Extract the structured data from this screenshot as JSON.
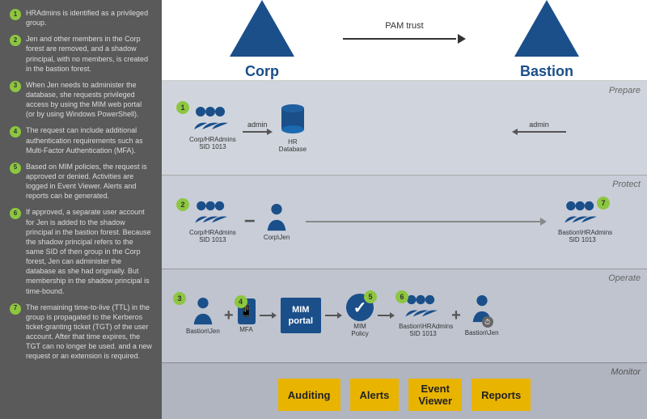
{
  "leftPanel": {
    "steps": [
      {
        "num": "1",
        "text": "HRAdmins is identified as a privileged group."
      },
      {
        "num": "2",
        "text": "Jen and other members in the Corp forest are removed, and a shadow principal, with no members, is created in the bastion forest."
      },
      {
        "num": "3",
        "text": "When Jen needs to administer the database, she requests privileged access by using the MIM web portal (or by using Windows PowerShell)."
      },
      {
        "num": "4",
        "text": "The request can include additional authentication requirements such as Multi-Factor Authentication (MFA)."
      },
      {
        "num": "5",
        "text": "Based on MIM policies, the request is approved or denied. Activities are logged in Event Viewer. Alerts and reports can be generated."
      },
      {
        "num": "6",
        "text": "If approved, a separate user account for Jen is added to the shadow principal in the bastion forest. Because the shadow principal refers to the same SID of then group in the Corp forest, Jen can administer the database as she had originally. But membership in the shadow principal is time-bound."
      },
      {
        "num": "7",
        "text": "The remaining time-to-live (TTL) in the group is propagated to the Kerberos ticket-granting ticket (TGT) of the user account. After that time expires, the TGT can no longer be used. and a new request or an extension is required."
      }
    ]
  },
  "topSection": {
    "corp_label": "Corp",
    "bastion_label": "Bastion",
    "pam_label": "PAM trust"
  },
  "prepare": {
    "label": "Prepare",
    "step_num": "1",
    "admin_label_left": "admin",
    "admin_label_right": "admin",
    "group_label": "Corp/HRAdmins\nSID 1013",
    "db_label": "HR\nDatabase"
  },
  "protect": {
    "label": "Protect",
    "step_num": "2",
    "group1_label": "Corp/HRAdmins\nSID 1013",
    "person_label": "Corp\\Jen",
    "group2_label": "Bastion\\HRAdmins\nSID 1013",
    "num7": "7"
  },
  "operate": {
    "label": "Operate",
    "step_num": "3",
    "person1_label": "Bastion\\Jen",
    "step4": "4",
    "mfa_label": "MFA",
    "mim_label": "MIM\nportal",
    "step5": "5",
    "policy_label": "MIM\nPolicy",
    "step6": "6",
    "group_label": "Bastion\\HRAdmins\nSID 1013",
    "person2_label": "Bastion\\Jen"
  },
  "monitor": {
    "label": "Monitor",
    "buttons": [
      "Auditing",
      "Alerts",
      "Event\nViewer",
      "Reports"
    ]
  }
}
